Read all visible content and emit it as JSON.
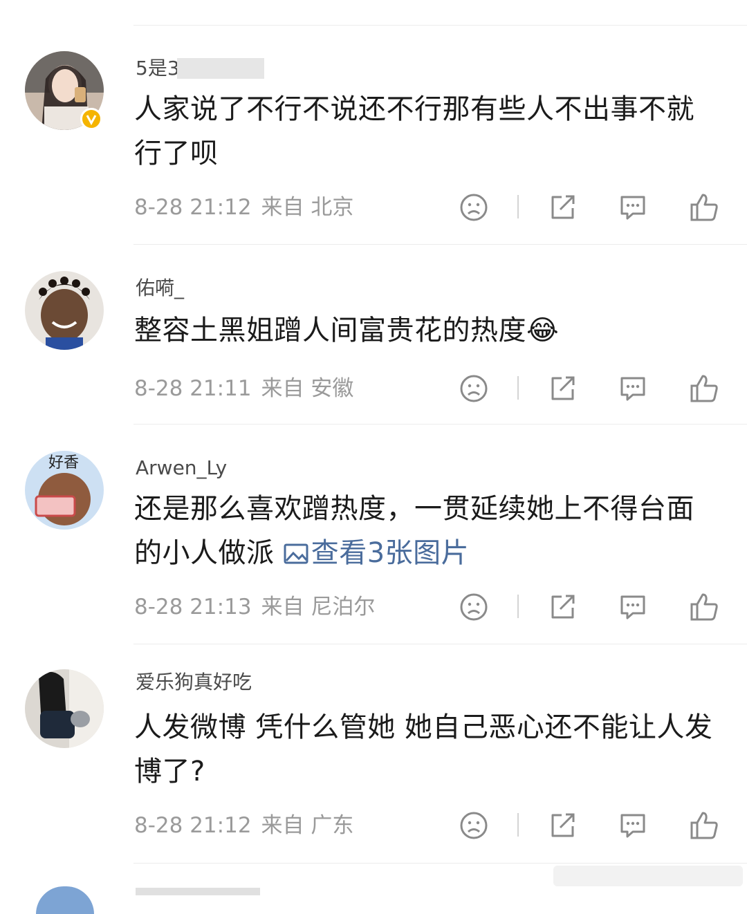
{
  "comments": [
    {
      "username": "5是3",
      "verified": true,
      "text": "人家说了不行不说还不行那有些人不出事不就行了呗",
      "image_link": "",
      "time": "8-28 21:12",
      "location": "来自 北京"
    },
    {
      "username": "佑嗬_",
      "verified": false,
      "text": "整容土黑姐蹭人间富贵花的热度",
      "emoji": "😂",
      "image_link": "",
      "time": "8-28 21:11",
      "location": "来自 安徽"
    },
    {
      "username": "Arwen_Ly",
      "verified": false,
      "text": "还是那么喜欢蹭热度，一贯延续她上不得台面的小人做派",
      "image_link": "查看3张图片",
      "time": "8-28 21:13",
      "location": "来自 尼泊尔"
    },
    {
      "username": "爱乐狗真好吃",
      "verified": false,
      "text": "人发微博 凭什么管她 她自己恶心还不能让人发博了?",
      "image_link": "",
      "time": "8-28 21:12",
      "location": "来自 广东"
    }
  ],
  "action_icons": [
    "dislike-face-icon",
    "share-icon",
    "comment-icon",
    "like-thumb-icon"
  ],
  "colors": {
    "text": "#1b1b1b",
    "meta": "#9a9a9a",
    "link": "#4a6c9c",
    "verified_badge": "#f5b400"
  }
}
